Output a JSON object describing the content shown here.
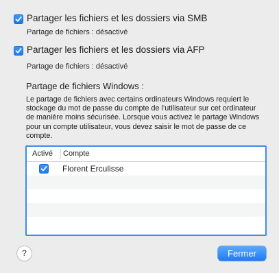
{
  "smb": {
    "label": "Partager les fichiers et les dossiers via SMB",
    "checked": true,
    "status": "Partage de fichiers : désactivé"
  },
  "afp": {
    "label": "Partager les fichiers et les dossiers via AFP",
    "checked": true,
    "status": "Partage de fichiers : désactivé"
  },
  "windows": {
    "title": "Partage de fichiers Windows :",
    "description": "Le partage de fichiers avec certains ordinateurs Windows requiert le stockage du mot de passe du compte de l’utilisateur sur cet ordinateur de manière moins sécurisée. Lorsque vous activez le partage Windows pour un compte utilisateur, vous devez saisir le mot de passe de ce compte."
  },
  "accounts_table": {
    "columns": [
      "Activé",
      "Compte"
    ],
    "rows": [
      {
        "enabled": true,
        "account": "Florent Erculisse"
      }
    ]
  },
  "footer": {
    "help_label": "?",
    "close_label": "Fermer"
  },
  "colors": {
    "accent": "#1f7ae0",
    "background": "#ececec"
  }
}
